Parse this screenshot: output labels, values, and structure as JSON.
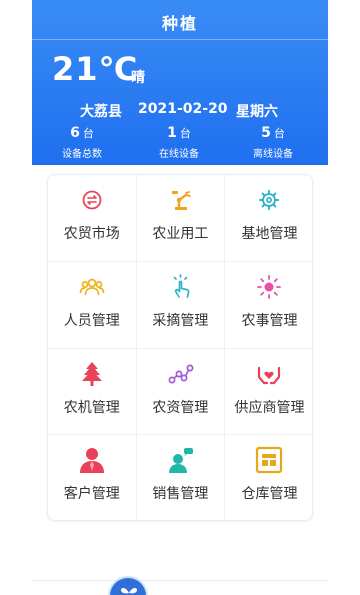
{
  "header": {
    "title": "种植",
    "temperature": "21℃",
    "weather": "晴",
    "county": "大荔县",
    "date": "2021-02-20",
    "weekday": "星期六",
    "stats": [
      {
        "value": "6",
        "unit": "台",
        "label": "设备总数"
      },
      {
        "value": "1",
        "unit": "台",
        "label": "在线设备"
      },
      {
        "value": "5",
        "unit": "台",
        "label": "离线设备"
      }
    ]
  },
  "menu": [
    {
      "label": "农贸市场",
      "icon": "exchange-icon",
      "color": "#e8425a"
    },
    {
      "label": "农业用工",
      "icon": "robot-arm-icon",
      "color": "#f2a21a"
    },
    {
      "label": "基地管理",
      "icon": "gear-icon",
      "color": "#2bb3c8"
    },
    {
      "label": "人员管理",
      "icon": "people-group-icon",
      "color": "#f2b21a"
    },
    {
      "label": "采摘管理",
      "icon": "hand-pick-icon",
      "color": "#2bb3c8"
    },
    {
      "label": "农事管理",
      "icon": "sun-icon",
      "color": "#e94fa8"
    },
    {
      "label": "农机管理",
      "icon": "tree-icon",
      "color": "#e8425a"
    },
    {
      "label": "农资管理",
      "icon": "nodes-icon",
      "color": "#a25bd6"
    },
    {
      "label": "供应商管理",
      "icon": "hands-heart-icon",
      "color": "#e8425a"
    },
    {
      "label": "客户管理",
      "icon": "person-icon",
      "color": "#e8425a"
    },
    {
      "label": "销售管理",
      "icon": "chat-person-icon",
      "color": "#1fb7a5"
    },
    {
      "label": "仓库管理",
      "icon": "warehouse-icon",
      "color": "#e6a817"
    }
  ]
}
